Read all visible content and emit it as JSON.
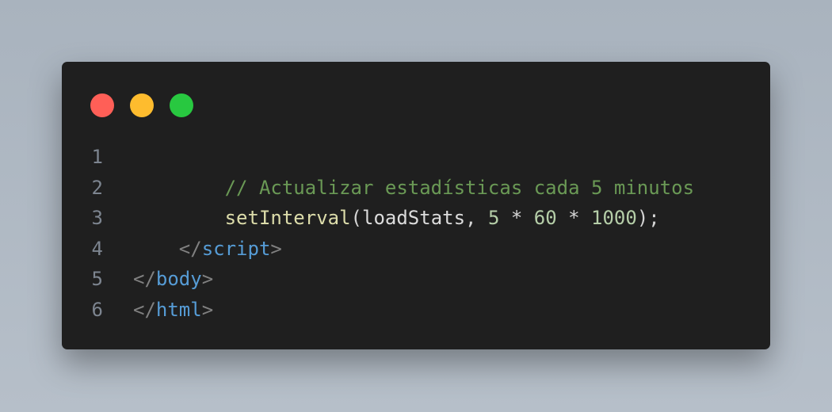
{
  "window": {
    "dots": [
      "close",
      "minimize",
      "maximize"
    ],
    "colors": {
      "background": "#1f1f1f",
      "close": "#ff5f57",
      "minimize": "#febc2e",
      "maximize": "#28c840"
    }
  },
  "code": {
    "lines": [
      {
        "number": "1",
        "indent": "",
        "tokens": []
      },
      {
        "number": "2",
        "indent": "        ",
        "tokens": [
          {
            "type": "comment",
            "text": "// Actualizar estadísticas cada 5 minutos"
          }
        ]
      },
      {
        "number": "3",
        "indent": "        ",
        "tokens": [
          {
            "type": "fn",
            "text": "setInterval"
          },
          {
            "type": "punc",
            "text": "("
          },
          {
            "type": "var",
            "text": "loadStats"
          },
          {
            "type": "punc",
            "text": ", "
          },
          {
            "type": "num",
            "text": "5"
          },
          {
            "type": "punc",
            "text": " * "
          },
          {
            "type": "num",
            "text": "60"
          },
          {
            "type": "punc",
            "text": " * "
          },
          {
            "type": "num",
            "text": "1000"
          },
          {
            "type": "punc",
            "text": ");"
          }
        ]
      },
      {
        "number": "4",
        "indent": "    ",
        "tokens": [
          {
            "type": "bracket",
            "text": "</"
          },
          {
            "type": "tag",
            "text": "script"
          },
          {
            "type": "bracket",
            "text": ">"
          }
        ]
      },
      {
        "number": "5",
        "indent": "",
        "tokens": [
          {
            "type": "bracket",
            "text": "</"
          },
          {
            "type": "tag",
            "text": "body"
          },
          {
            "type": "bracket",
            "text": ">"
          }
        ]
      },
      {
        "number": "6",
        "indent": "",
        "tokens": [
          {
            "type": "bracket",
            "text": "</"
          },
          {
            "type": "tag",
            "text": "html"
          },
          {
            "type": "bracket",
            "text": ">"
          }
        ]
      }
    ]
  }
}
